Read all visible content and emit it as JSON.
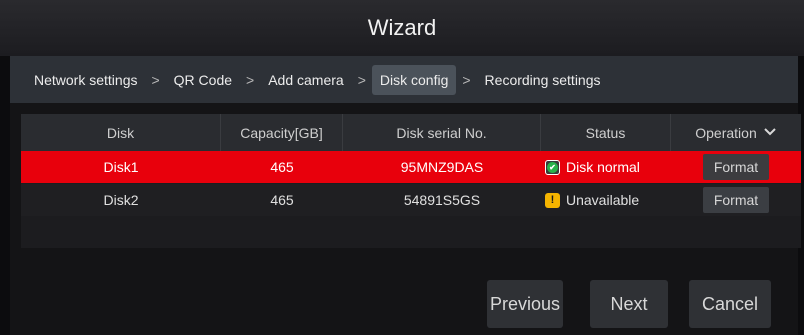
{
  "window": {
    "title": "Wizard"
  },
  "steps": [
    {
      "label": "Network settings"
    },
    {
      "label": "QR Code"
    },
    {
      "label": "Add camera"
    },
    {
      "label": "Disk config"
    },
    {
      "label": "Recording settings"
    }
  ],
  "step_separator": ">",
  "table": {
    "headers": {
      "disk": "Disk",
      "capacity": "Capacity[GB]",
      "serial": "Disk serial No.",
      "status": "Status",
      "operation": "Operation"
    },
    "rows": [
      {
        "disk": "Disk1",
        "capacity": "465",
        "serial": "95MNZ9DAS",
        "status": "Disk normal",
        "status_icon": "check-icon",
        "operation": "Format"
      },
      {
        "disk": "Disk2",
        "capacity": "465",
        "serial": "54891S5GS",
        "status": "Unavailable",
        "status_icon": "warning-icon",
        "operation": "Format"
      }
    ]
  },
  "buttons": {
    "previous": "Previous",
    "next": "Next",
    "cancel": "Cancel"
  },
  "colors": {
    "selected_row": "#e8000c",
    "ok_icon": "#29b24a",
    "warn_icon": "#f5b400"
  }
}
